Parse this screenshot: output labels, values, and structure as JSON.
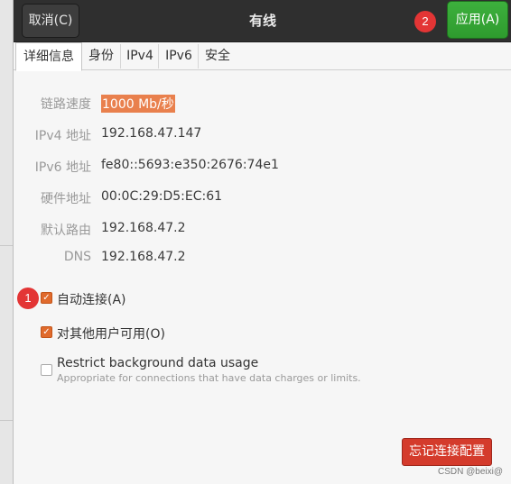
{
  "header": {
    "cancel_label": "取消(C)",
    "title": "有线",
    "apply_label": "应用(A)"
  },
  "markers": {
    "one": "1",
    "two": "2"
  },
  "tabs": [
    "详细信息",
    "身份",
    "IPv4",
    "IPv6",
    "安全"
  ],
  "details": [
    {
      "label": "链路速度",
      "value": "1000 Mb/秒"
    },
    {
      "label": "IPv4 地址",
      "value": "192.168.47.147"
    },
    {
      "label": "IPv6 地址",
      "value": "fe80::5693:e350:2676:74e1"
    },
    {
      "label": "硬件地址",
      "value": "00:0C:29:D5:EC:61"
    },
    {
      "label": "默认路由",
      "value": "192.168.47.2"
    },
    {
      "label": "DNS",
      "value": "192.168.47.2"
    }
  ],
  "options": {
    "auto_connect": {
      "label": "自动连接(A)",
      "checked": true
    },
    "all_users": {
      "label": "对其他用户可用(O)",
      "checked": true
    },
    "restrict_bg": {
      "label": "Restrict background data usage",
      "sublabel": "Appropriate for connections that have data charges or limits.",
      "checked": false
    }
  },
  "forget_label": "忘记连接配置",
  "watermark": "CSDN @beixi@",
  "colors": {
    "apply": "#33a333",
    "accent": "#e06a2c",
    "destructive": "#d43b2c",
    "marker": "#e33535"
  }
}
